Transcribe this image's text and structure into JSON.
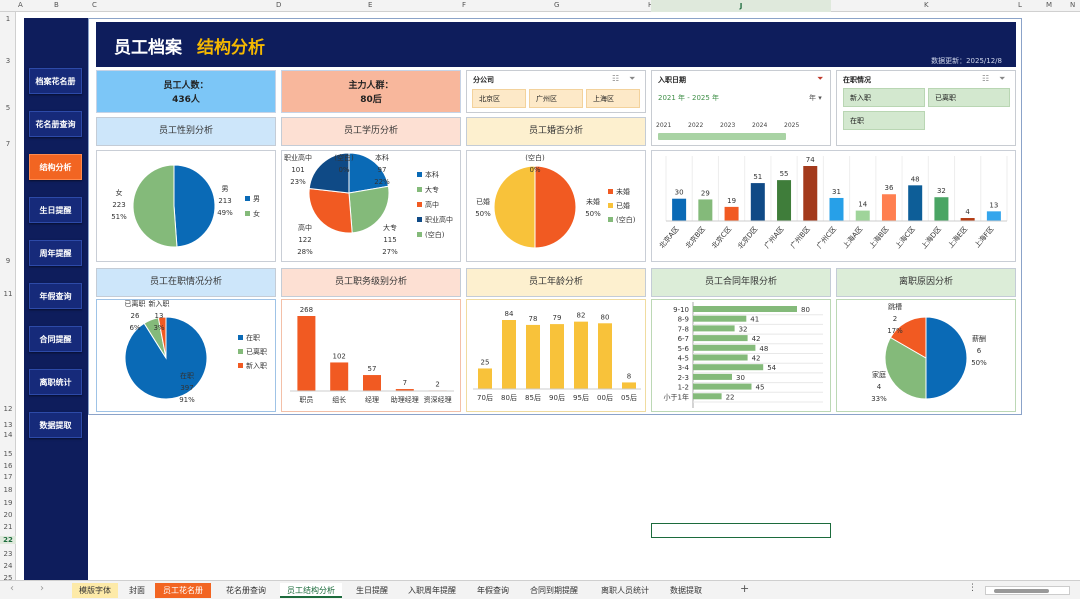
{
  "sheet": {
    "columns": [
      "A",
      "B",
      "C",
      "D",
      "E",
      "F",
      "G",
      "H",
      "I",
      "J",
      "K",
      "L",
      "M",
      "N"
    ],
    "selected_column": "J",
    "rows": [
      "1",
      "3",
      "5",
      "7",
      "9",
      "11",
      "12",
      "13",
      "14",
      "15",
      "16",
      "17",
      "18",
      "19",
      "20",
      "21",
      "22",
      "23",
      "24",
      "25"
    ],
    "selected_row": "22"
  },
  "nav": {
    "items": [
      "档案花名册",
      "花名册查询",
      "结构分析",
      "生日提醒",
      "周年提醒",
      "年假查询",
      "合同提醒",
      "离职统计",
      "数据提取"
    ],
    "active": 2
  },
  "header": {
    "title_a": "员工档案",
    "title_b": "结构分析",
    "updated": "数据更新：2025/12/8"
  },
  "kpis": {
    "headcount_label": "员工人数：",
    "headcount_value": "436人",
    "main_group_label": "主力人群：",
    "main_group_value": "80后"
  },
  "slicers": {
    "branch": {
      "title": "分公司",
      "items": [
        "北京区",
        "广州区",
        "上海区"
      ]
    },
    "hire": {
      "title": "入职日期",
      "range": "2021 年 - 2025 年",
      "unit": "年",
      "years": [
        "2021",
        "2022",
        "2023",
        "2024",
        "2025"
      ]
    },
    "status": {
      "title": "在职情况",
      "items": [
        "新入职",
        "已离职",
        "在职"
      ]
    }
  },
  "colors": {
    "navy": "#0e1d5c",
    "blue": "#0a6ab6",
    "green": "#84ba7a",
    "orange": "#f15a22",
    "darkblue": "#0f4a86",
    "yellow": "#f8c23a",
    "accent": "#f5b800"
  },
  "cards": {
    "gender": {
      "title": "员工性别分析"
    },
    "edu": {
      "title": "员工学历分析"
    },
    "marital": {
      "title": "员工婚否分析"
    },
    "status": {
      "title": "员工在职情况分析"
    },
    "grade": {
      "title": "员工职务级别分析"
    },
    "age": {
      "title": "员工年龄分析"
    },
    "contract": {
      "title": "员工合同年限分析"
    },
    "leave": {
      "title": "离职原因分析"
    }
  },
  "chart_data": [
    {
      "id": "gender",
      "type": "pie",
      "slices": [
        {
          "name": "男",
          "value": 213,
          "pct": "49%",
          "color": "#0a6ab6"
        },
        {
          "name": "女",
          "value": 223,
          "pct": "51%",
          "color": "#84ba7a"
        }
      ],
      "legend": [
        "男",
        "女"
      ]
    },
    {
      "id": "edu",
      "type": "pie",
      "slices": [
        {
          "name": "本科",
          "value": 97,
          "pct": "22%",
          "color": "#0a6ab6"
        },
        {
          "name": "大专",
          "value": 115,
          "pct": "27%",
          "color": "#84ba7a"
        },
        {
          "name": "高中",
          "value": 122,
          "pct": "28%",
          "color": "#f15a22"
        },
        {
          "name": "职业高中",
          "value": 101,
          "pct": "23%",
          "color": "#0f4a86"
        },
        {
          "name": "(空白)",
          "value": 0,
          "pct": "0%",
          "color": "#84ba7a"
        }
      ],
      "legend": [
        "本科",
        "大专",
        "高中",
        "职业高中",
        "(空白)"
      ]
    },
    {
      "id": "marital",
      "type": "pie",
      "slices": [
        {
          "name": "未婚",
          "value": 50,
          "pct": "50%",
          "color": "#f15a22"
        },
        {
          "name": "已婚",
          "value": 50,
          "pct": "50%",
          "color": "#f8c23a"
        },
        {
          "name": "(空白)",
          "value": 0,
          "pct": "0%",
          "color": "#84ba7a"
        }
      ],
      "legend": [
        "未婚",
        "已婚",
        "(空白)"
      ]
    },
    {
      "id": "branch",
      "type": "bar",
      "categories": [
        "北京A区",
        "北京B区",
        "北京C区",
        "北京D区",
        "广州A区",
        "广州B区",
        "广州C区",
        "上海A区",
        "上海B区",
        "上海C区",
        "上海D区",
        "上海E区",
        "上海F区"
      ],
      "values": [
        30,
        29,
        19,
        51,
        55,
        74,
        31,
        14,
        36,
        48,
        32,
        4,
        13
      ],
      "colors": [
        "#0a6ab6",
        "#84ba7a",
        "#f15a22",
        "#0f4a86",
        "#3f7d3a",
        "#a33a1c",
        "#27a0e8",
        "#9fd49a",
        "#ff7f50",
        "#0d5e98",
        "#4aa564",
        "#b33b12",
        "#34a5ec"
      ]
    },
    {
      "id": "status",
      "type": "pie",
      "slices": [
        {
          "name": "在职",
          "value": 397,
          "pct": "91%",
          "color": "#0a6ab6"
        },
        {
          "name": "已离职",
          "value": 26,
          "pct": "6%",
          "color": "#84ba7a"
        },
        {
          "name": "新入职",
          "value": 13,
          "pct": "3%",
          "color": "#f15a22"
        }
      ],
      "legend": [
        "在职",
        "已离职",
        "新入职"
      ]
    },
    {
      "id": "grade",
      "type": "bar",
      "categories": [
        "职员",
        "组长",
        "经理",
        "助理经理",
        "资深经理"
      ],
      "values": [
        268,
        102,
        57,
        7,
        2
      ],
      "color": "#f15a22"
    },
    {
      "id": "age",
      "type": "bar",
      "categories": [
        "70后",
        "80后",
        "85后",
        "90后",
        "95后",
        "00后",
        "05后"
      ],
      "values": [
        25,
        84,
        78,
        79,
        82,
        80,
        8
      ],
      "color": "#f8c23a"
    },
    {
      "id": "contract",
      "type": "hbar",
      "categories": [
        "9-10",
        "8-9",
        "7-8",
        "6-7",
        "5-6",
        "4-5",
        "3-4",
        "2-3",
        "1-2",
        "小于1年"
      ],
      "values": [
        80,
        41,
        32,
        42,
        48,
        42,
        54,
        30,
        45,
        22
      ],
      "color": "#84ba7a"
    },
    {
      "id": "leave",
      "type": "pie",
      "slices": [
        {
          "name": "薪酬",
          "value": 6,
          "pct": "50%",
          "color": "#0a6ab6"
        },
        {
          "name": "家庭",
          "value": 4,
          "pct": "33%",
          "color": "#84ba7a"
        },
        {
          "name": "跳槽",
          "value": 2,
          "pct": "17%",
          "color": "#f15a22"
        }
      ]
    }
  ],
  "tabs": {
    "items": [
      "模版字体",
      "封面",
      "员工花名册",
      "花名册查询",
      "员工结构分析",
      "生日提醒",
      "入职周年提醒",
      "年假查询",
      "合同到期提醒",
      "离职人员统计",
      "数据提取"
    ],
    "active": 4,
    "add": "+",
    "prev": "‹",
    "next": "›",
    "menu": "⋮"
  }
}
